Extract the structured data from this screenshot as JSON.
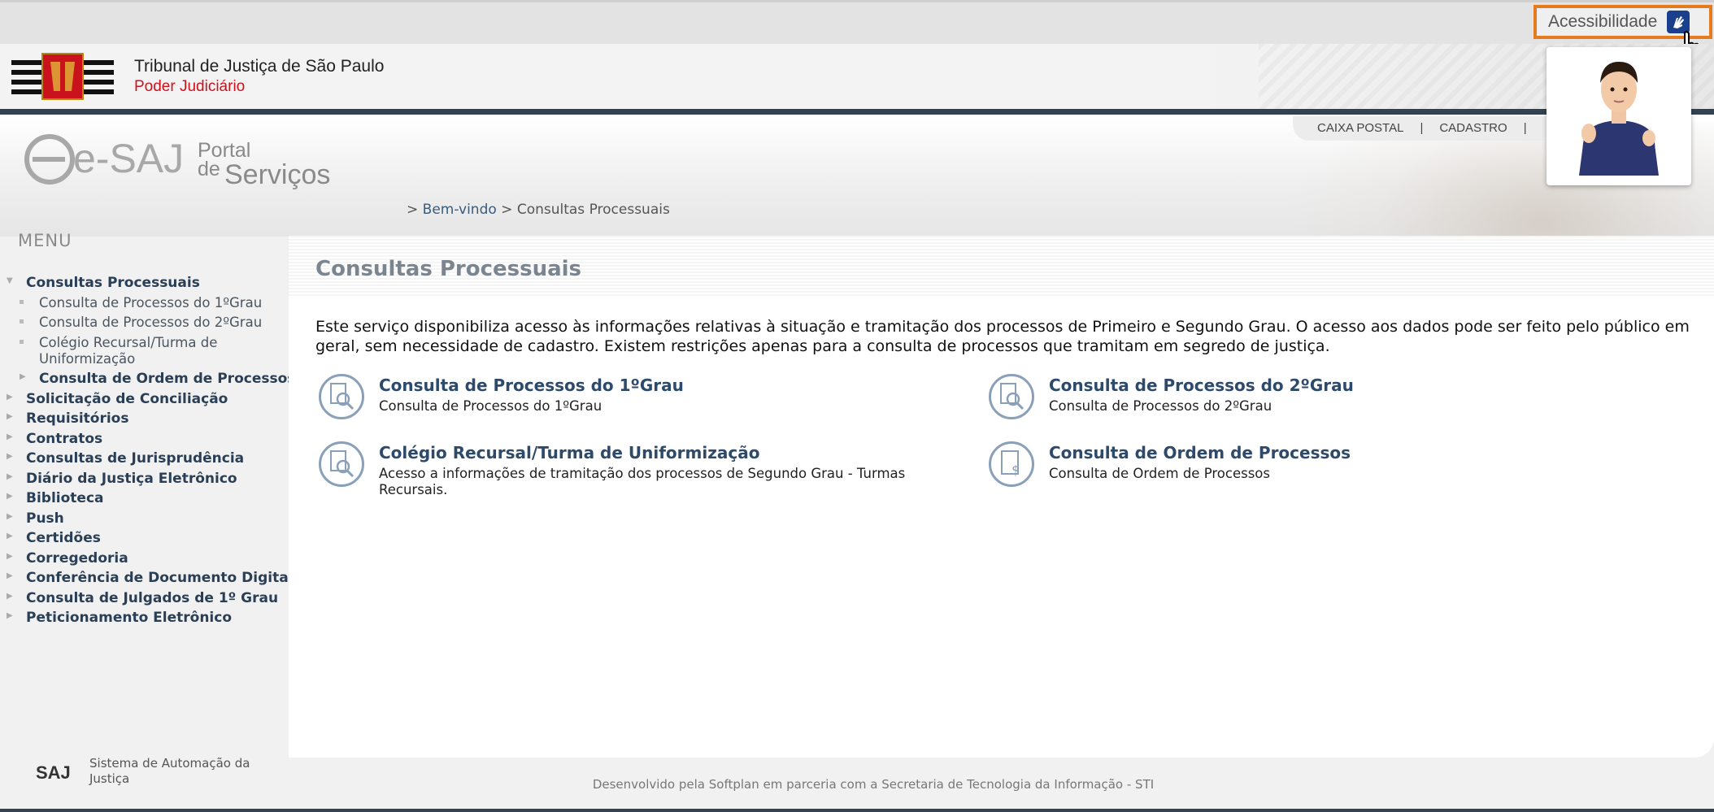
{
  "accessibility": {
    "label": "Acessibilidade"
  },
  "header": {
    "court_name": "Tribunal de Justiça de São Paulo",
    "court_sub": "Poder Judiciário"
  },
  "portal": {
    "brand": "e-SAJ",
    "portal_word": "Portal",
    "de_word": "de",
    "servicos_word": "Serviços"
  },
  "toplinks": {
    "caixa": "CAIXA POSTAL",
    "sep": "|",
    "cadastro": "CADASTRO"
  },
  "breadcrumb": {
    "prefix": ">",
    "home": "Bem-vindo",
    "sep": ">",
    "current": "Consultas Processuais"
  },
  "menu": {
    "title": "MENU",
    "items": [
      {
        "label": "Consultas Processuais"
      },
      {
        "label": "Consulta de Processos do 1ºGrau"
      },
      {
        "label": "Consulta de Processos do 2ºGrau"
      },
      {
        "label": "Colégio Recursal/Turma de"
      },
      {
        "label": "Uniformização"
      },
      {
        "label": "Consulta de Ordem de Processos"
      },
      {
        "label": "Solicitação de Conciliação"
      },
      {
        "label": "Requisitórios"
      },
      {
        "label": "Contratos"
      },
      {
        "label": "Consultas de Jurisprudência"
      },
      {
        "label": "Diário da Justiça Eletrônico"
      },
      {
        "label": "Biblioteca"
      },
      {
        "label": "Push"
      },
      {
        "label": "Certidões"
      },
      {
        "label": "Corregedoria"
      },
      {
        "label": "Conferência de Documento Digital"
      },
      {
        "label": "Consulta de Julgados de 1º Grau"
      },
      {
        "label": "Peticionamento Eletrônico"
      }
    ]
  },
  "main": {
    "title": "Consultas Processuais",
    "intro": "Este serviço disponibiliza acesso às informações relativas à situação e tramitação dos processos de Primeiro e Segundo Grau. O acesso aos dados pode ser feito pelo público em geral, sem necessidade de cadastro. Existem restrições apenas para a consulta de processos que tramitam em segredo de justiça.",
    "cards": [
      {
        "title": "Consulta de Processos do 1ºGrau",
        "desc": "Consulta de Processos do 1ºGrau",
        "icon": "1"
      },
      {
        "title": "Consulta de Processos do 2ºGrau",
        "desc": "Consulta de Processos do 2ºGrau",
        "icon": "2"
      },
      {
        "title": "Colégio Recursal/Turma de Uniformização",
        "desc": "Acesso a informações de tramitação dos processos de Segundo Grau - Turmas Recursais.",
        "icon": "3"
      },
      {
        "title": "Consulta de Ordem de Processos",
        "desc": "Consulta de Ordem de Processos",
        "icon": "$"
      }
    ]
  },
  "footer": {
    "logo": "SAJ",
    "system": "Sistema de Automação da Justiça",
    "developed": "Desenvolvido pela Softplan em parceria com a Secretaria de Tecnologia da Informação - STI"
  },
  "colors": {
    "accent_orange": "#e57b1f",
    "dark_bar": "#34424f",
    "link_blue": "#2e4a6b",
    "court_red": "#d0101a"
  }
}
